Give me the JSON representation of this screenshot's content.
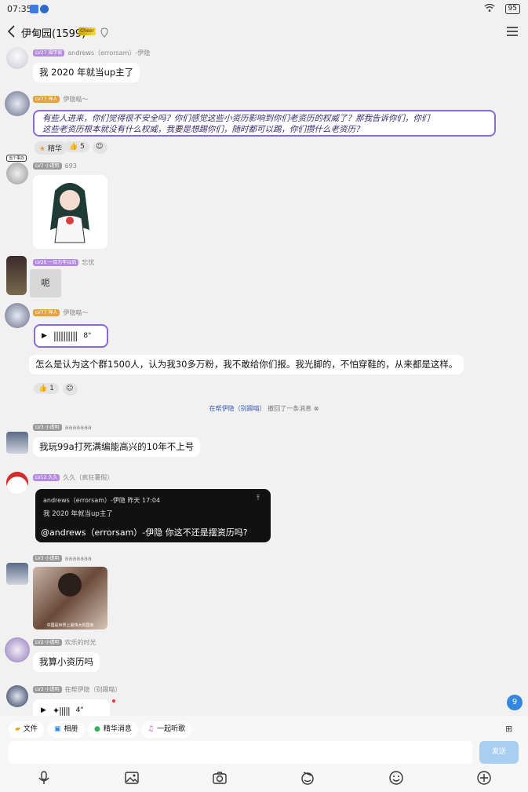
{
  "status": {
    "time": "07:35",
    "battery": "95"
  },
  "header": {
    "title": "伊甸园(1599)",
    "badge": "Cheer"
  },
  "messages": [
    {
      "level": "LV27 福学家",
      "name": "andrews（errorsam）-伊隐",
      "text": "我 2020 年就当up主了"
    },
    {
      "level": "LV77 神人",
      "name": "伊隐喵～",
      "text_line1": "有些人进来，你们觉得很不安全吗？你们感觉这些小资历影响到你们老资历的权威了？那我告诉你们，你们",
      "text_line2": "这些老资历根本就没有什么权威，我要是想踢你们，随时都可以踢，你们攒什么老资历？",
      "reactions": {
        "essence": "精华",
        "like_count": "5"
      }
    },
    {
      "avatar_tag": "当个事办",
      "level": "LV7 小透明",
      "name": "693"
    },
    {
      "level": "LV29 一百万年以后",
      "name": "忘忧",
      "sticker_text": "呃"
    },
    {
      "level": "LV77 神人",
      "name": "伊隐喵～",
      "voice_duration": "8\"",
      "text": "怎么是认为这个群1500人，认为我30多万粉，我不敢给你们报。我光脚的，不怕穿鞋的，从来都是这样。",
      "reactions": {
        "like_count": "1"
      }
    },
    {
      "notice_who": "在帮伊隐（别踢喵）",
      "notice_text": "撤回了一条消息"
    },
    {
      "level": "LV3 小透明",
      "name": "aaaaaaa",
      "text": "我玩99a打死满编能高兴的10年不上号"
    },
    {
      "level": "LV12 久久",
      "name": "久久（疯狂薯假）",
      "quote_header": "andrews（errorsam）-伊隐 昨天 17:04",
      "quote_text": "我 2020 年就当up主了",
      "text": "@andrews（errorsam）-伊隐 你这不还是摆资历吗?"
    },
    {
      "level": "LV3 小透明",
      "name": "aaaaaaa",
      "image_caption": "中国是世界上最伟大的国家"
    },
    {
      "level": "LV2 小透明",
      "name": "欢乐的时光",
      "text": "我算小资历吗"
    },
    {
      "level": "LV3 小透明",
      "name": "在帮伊隐（别踢喵）",
      "voice_duration": "4\""
    }
  ],
  "unread_count": "9",
  "shortcuts": [
    "文件",
    "相册",
    "精华消息",
    "一起听歌"
  ],
  "input": {
    "send_label": "发送"
  },
  "colors": {
    "accent": "#3387e0",
    "level_purple": "#b58be0",
    "level_gold": "#e3a33a",
    "level_gray": "#9a9a9a"
  }
}
